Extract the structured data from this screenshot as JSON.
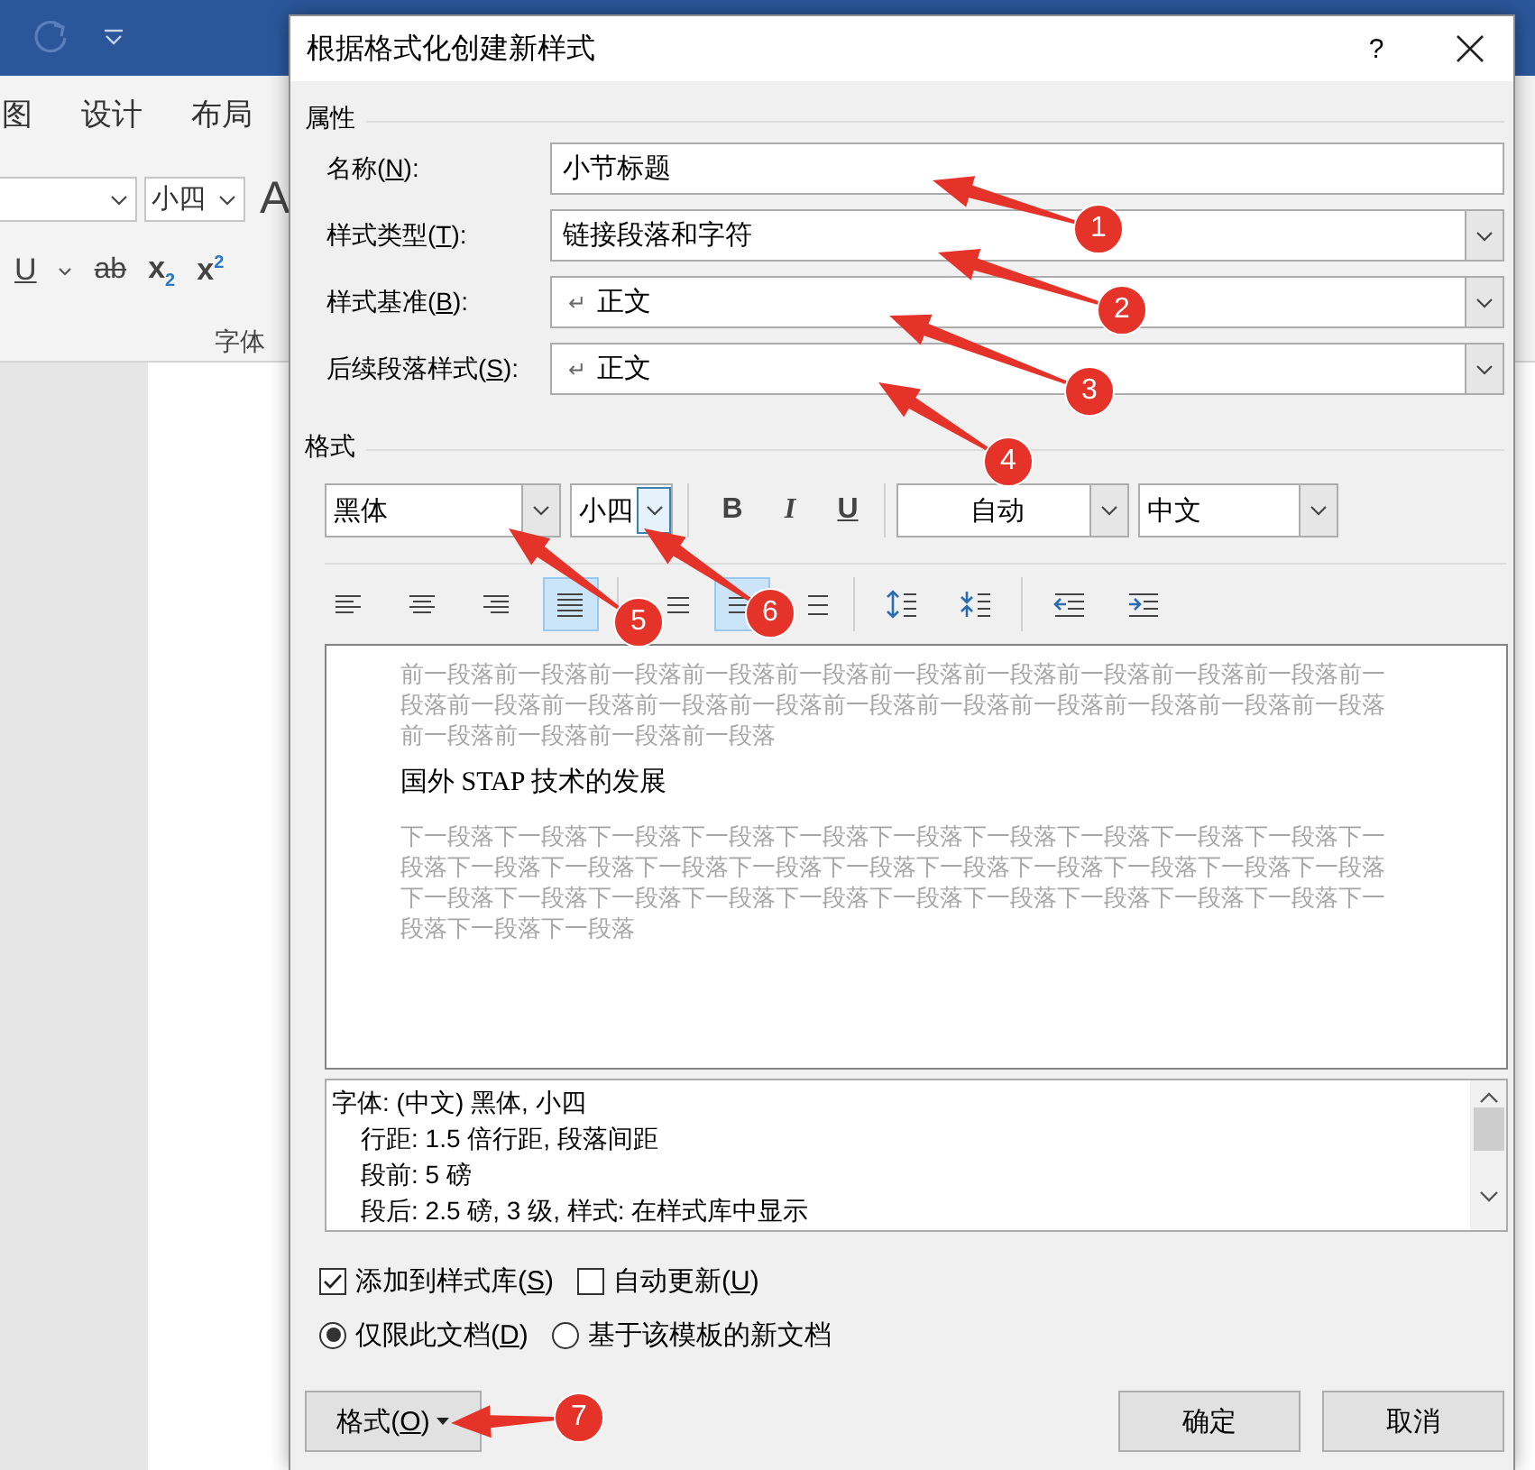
{
  "word_window": {
    "ribbon_tabs": [
      "图",
      "设计",
      "布局"
    ],
    "font_size": "小四",
    "grow_font": "A",
    "format_buttons": [
      {
        "kind": "underline",
        "label": "U"
      },
      {
        "kind": "caret"
      },
      {
        "kind": "strikethrough",
        "label": "ab"
      },
      {
        "kind": "subscript",
        "label": "x$_{2}$"
      },
      {
        "kind": "superscript",
        "label": "x$^{2}$"
      }
    ],
    "group_label": "字体"
  },
  "dialog": {
    "title": "根据格式化创建新样式",
    "help": "?",
    "properties": {
      "heading": "属性",
      "fields": [
        {
          "kind": "text",
          "label_before": "名称(",
          "access_key": "N",
          "label_after": "):",
          "value": "小节标题"
        },
        {
          "kind": "dropdown",
          "label_before": "样式类型(",
          "access_key": "T",
          "label_after": "):",
          "value": "链接段落和字符"
        },
        {
          "kind": "dropdown",
          "label_before": "样式基准(",
          "access_key": "B",
          "label_after": "):",
          "prefix": "↵",
          "value": "正文"
        },
        {
          "kind": "dropdown",
          "label_before": "后续段落样式(",
          "access_key": "S",
          "label_after": "):",
          "prefix": "↵",
          "value": "正文"
        }
      ]
    },
    "formatting": {
      "heading": "格式",
      "font": "黑体",
      "size": "小四",
      "size_focused": true,
      "text_styles": [
        {
          "kind": "bold",
          "label": "B",
          "selected": false
        },
        {
          "kind": "italic",
          "label": "I",
          "selected": false
        },
        {
          "kind": "underline",
          "label": "U",
          "selected": false
        }
      ],
      "tint": "自动",
      "language": "中文",
      "paragraph_groups": [
        [
          {
            "kind": "align-left",
            "selected": false
          },
          {
            "kind": "align-center",
            "selected": false
          },
          {
            "kind": "align-right",
            "selected": false
          },
          {
            "kind": "justify",
            "selected": true
          }
        ],
        [
          {
            "kind": "single-spacing",
            "selected": false
          },
          {
            "kind": "one-half-spacing",
            "selected": true
          },
          {
            "kind": "double-spacing",
            "selected": false
          }
        ],
        [
          {
            "kind": "space-increase",
            "selected": false
          },
          {
            "kind": "space-decrease",
            "selected": false
          }
        ],
        [
          {
            "kind": "indent-decrease",
            "selected": false
          },
          {
            "kind": "indent-increase",
            "selected": false
          }
        ]
      ]
    },
    "preview": {
      "previous_paragraph": "前一段落前一段落前一段落前一段落前一段落前一段落前一段落前一段落前一段落前一段落前一段落前一段落前一段落前一段落前一段落前一段落前一段落前一段落前一段落前一段落前一段落前一段落前一段落前一段落前一段落",
      "sample": "国外 STAP 技术的发展",
      "next_paragraph": "下一段落下一段落下一段落下一段落下一段落下一段落下一段落下一段落下一段落下一段落下一段落下一段落下一段落下一段落下一段落下一段落下一段落下一段落下一段落下一段落下一段落下一段落下一段落下一段落下一段落下一段落下一段落下一段落下一段落下一段落下一段落下一段落下一段落下一段落"
    },
    "description": [
      "字体: (中文) 黑体, 小四",
      "行距: 1.5 倍行距, 段落间距",
      "段前: 5 磅",
      "段后: 2.5 磅, 3 级, 样式: 在样式库中显示"
    ],
    "checkboxes": [
      {
        "label_before": "添加到样式库(",
        "access_key": "S",
        "label_after": ")",
        "checked": true
      },
      {
        "label_before": "自动更新(",
        "access_key": "U",
        "label_after": ")",
        "checked": false
      }
    ],
    "radios": [
      {
        "label_before": "仅限此文档(",
        "access_key": "D",
        "label_after": ")",
        "selected": true
      },
      {
        "label_before": "基于该模板的新文档",
        "selected": false
      }
    ],
    "buttons": [
      {
        "kind": "menu",
        "label_before": "格式(",
        "access_key": "O",
        "label_after": ")"
      },
      {
        "kind": "plain",
        "label_before": "确定"
      },
      {
        "kind": "plain",
        "label_before": "取消"
      }
    ]
  },
  "annotations": [
    {
      "number": "1"
    },
    {
      "number": "2"
    },
    {
      "number": "3"
    },
    {
      "number": "4"
    },
    {
      "number": "5"
    },
    {
      "number": "6"
    },
    {
      "number": "7"
    }
  ]
}
